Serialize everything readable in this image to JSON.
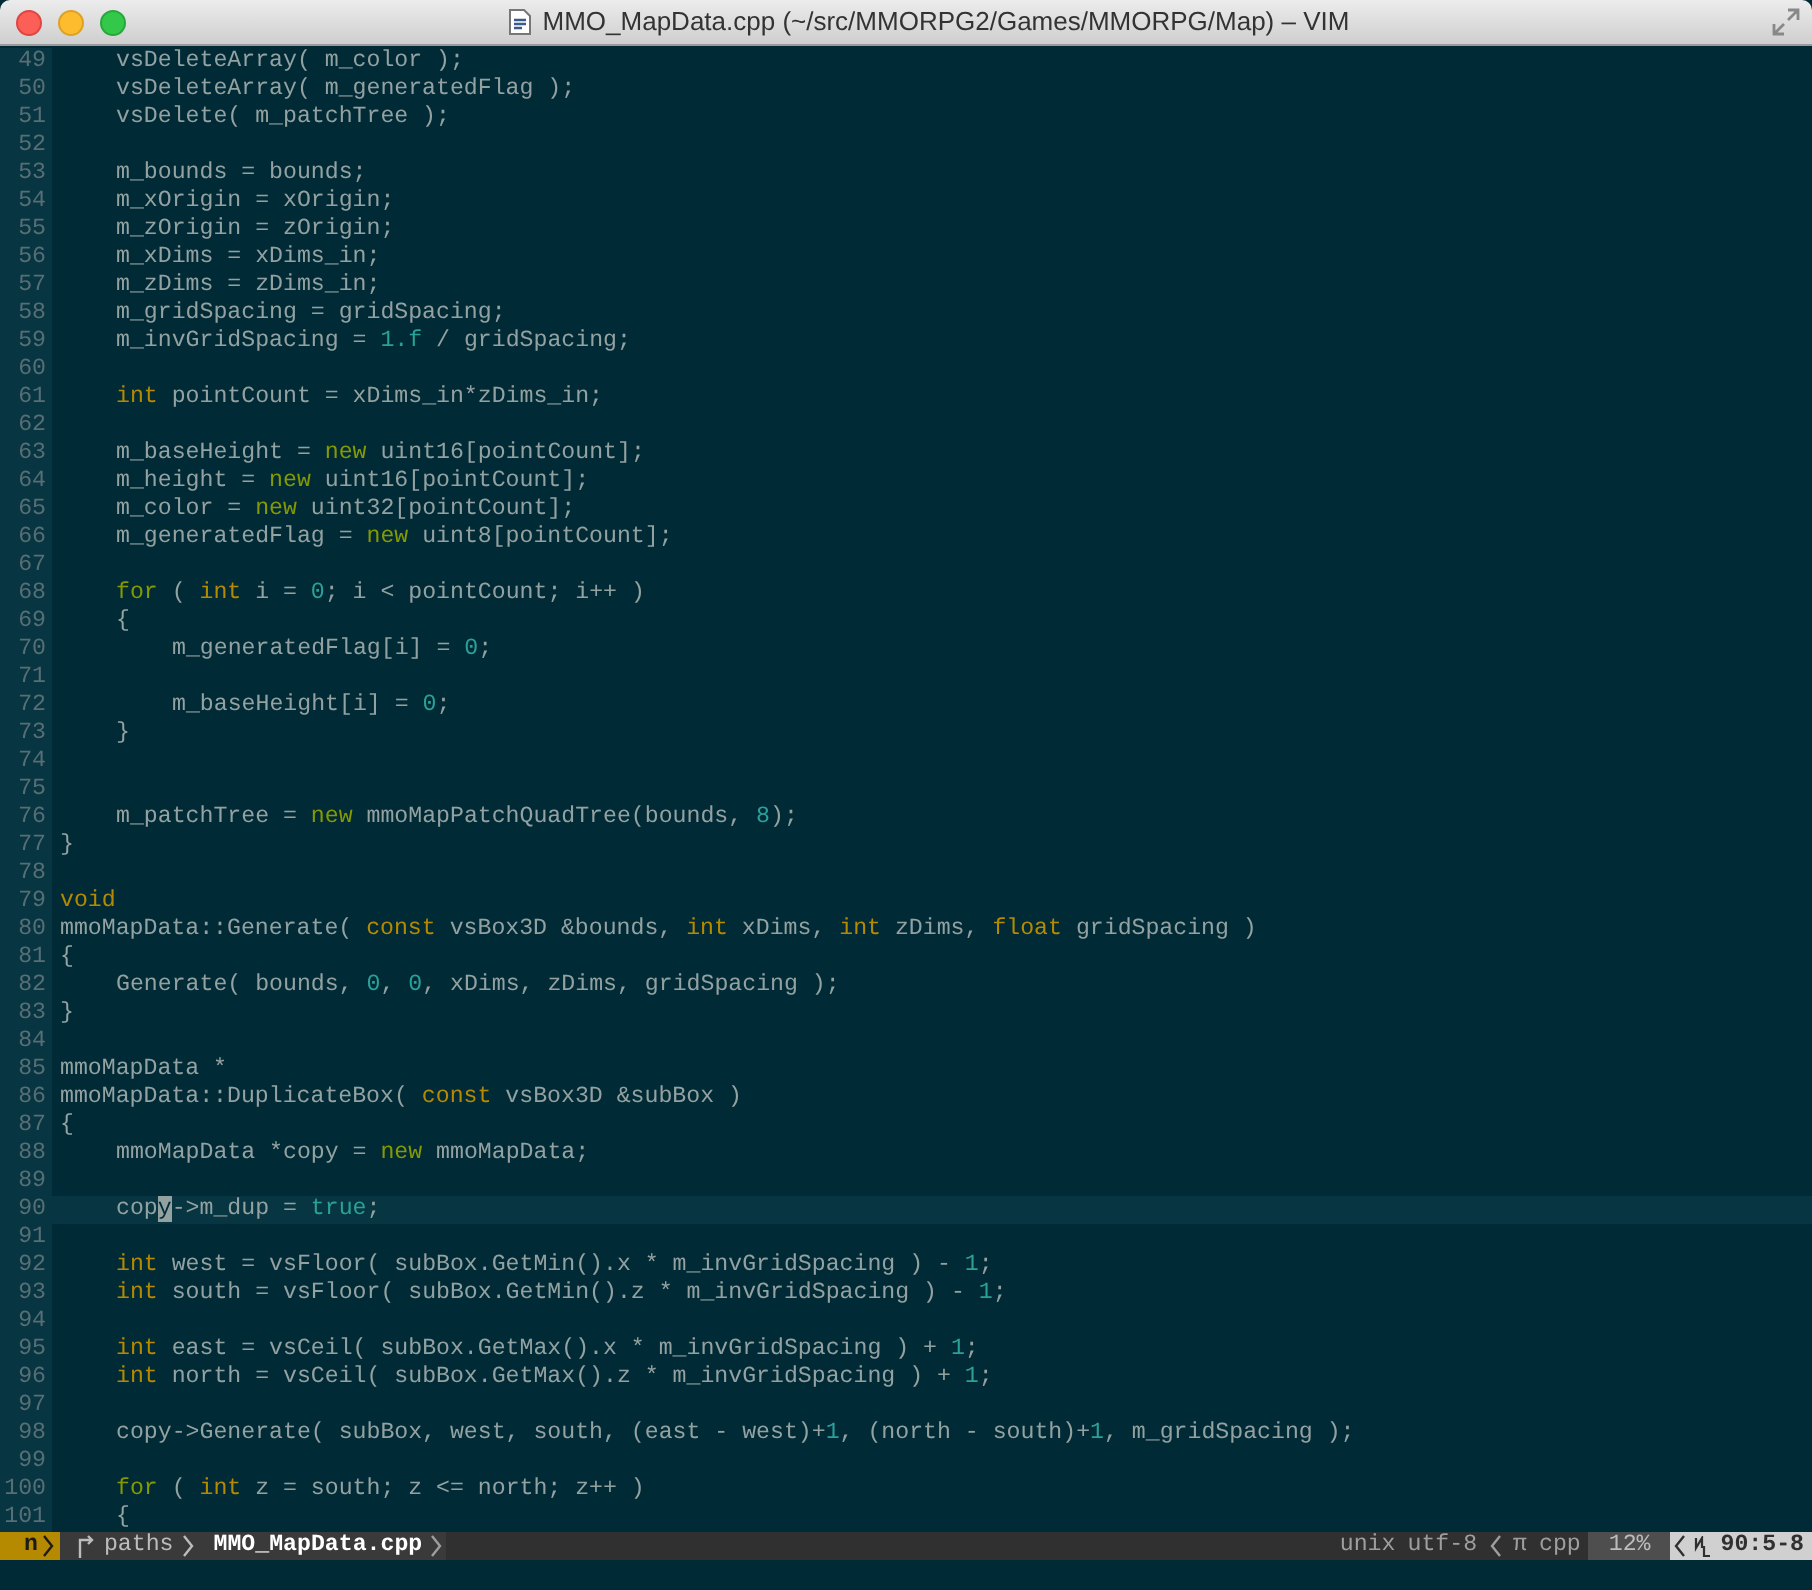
{
  "window": {
    "title": "MMO_MapData.cpp (~/src/MMORPG2/Games/MMORPG/Map) – VIM"
  },
  "editor": {
    "lines": [
      {
        "number": "49",
        "current": false,
        "segments": [
          {
            "kind": "plain",
            "text": "    vsDeleteArray( m_color );"
          }
        ]
      },
      {
        "number": "50",
        "current": false,
        "segments": [
          {
            "kind": "plain",
            "text": "    vsDeleteArray( m_generatedFlag );"
          }
        ]
      },
      {
        "number": "51",
        "current": false,
        "segments": [
          {
            "kind": "plain",
            "text": "    vsDelete( m_patchTree );"
          }
        ]
      },
      {
        "number": "52",
        "current": false
      },
      {
        "number": "53",
        "current": false,
        "segments": [
          {
            "kind": "plain",
            "text": "    m_bounds = bounds;"
          }
        ]
      },
      {
        "number": "54",
        "current": false,
        "segments": [
          {
            "kind": "plain",
            "text": "    m_xOrigin = xOrigin;"
          }
        ]
      },
      {
        "number": "55",
        "current": false,
        "segments": [
          {
            "kind": "plain",
            "text": "    m_zOrigin = zOrigin;"
          }
        ]
      },
      {
        "number": "56",
        "current": false,
        "segments": [
          {
            "kind": "plain",
            "text": "    m_xDims = xDims_in;"
          }
        ]
      },
      {
        "number": "57",
        "current": false,
        "segments": [
          {
            "kind": "plain",
            "text": "    m_zDims = zDims_in;"
          }
        ]
      },
      {
        "number": "58",
        "current": false,
        "segments": [
          {
            "kind": "plain",
            "text": "    m_gridSpacing = gridSpacing;"
          }
        ]
      },
      {
        "number": "59",
        "current": false,
        "segments": [
          {
            "kind": "plain",
            "text": "    m_invGridSpacing = "
          },
          {
            "kind": "number",
            "text": "1.f"
          },
          {
            "kind": "plain",
            "text": " / gridSpacing;"
          }
        ]
      },
      {
        "number": "60",
        "current": false
      },
      {
        "number": "61",
        "current": false,
        "segments": [
          {
            "kind": "type",
            "text": "    int"
          },
          {
            "kind": "plain",
            "text": " pointCount = xDims_in*zDims_in;"
          }
        ]
      },
      {
        "number": "62",
        "current": false
      },
      {
        "number": "63",
        "current": false,
        "segments": [
          {
            "kind": "plain",
            "text": "    m_baseHeight = "
          },
          {
            "kind": "keyword",
            "text": "new"
          },
          {
            "kind": "plain",
            "text": " uint16[pointCount];"
          }
        ]
      },
      {
        "number": "64",
        "current": false,
        "segments": [
          {
            "kind": "plain",
            "text": "    m_height = "
          },
          {
            "kind": "keyword",
            "text": "new"
          },
          {
            "kind": "plain",
            "text": " uint16[pointCount];"
          }
        ]
      },
      {
        "number": "65",
        "current": false,
        "segments": [
          {
            "kind": "plain",
            "text": "    m_color = "
          },
          {
            "kind": "keyword",
            "text": "new"
          },
          {
            "kind": "plain",
            "text": " uint32[pointCount];"
          }
        ]
      },
      {
        "number": "66",
        "current": false,
        "segments": [
          {
            "kind": "plain",
            "text": "    m_generatedFlag = "
          },
          {
            "kind": "keyword",
            "text": "new"
          },
          {
            "kind": "plain",
            "text": " uint8[pointCount];"
          }
        ]
      },
      {
        "number": "67",
        "current": false
      },
      {
        "number": "68",
        "current": false,
        "segments": [
          {
            "kind": "keyword",
            "text": "    for"
          },
          {
            "kind": "plain",
            "text": " ( "
          },
          {
            "kind": "type",
            "text": "int"
          },
          {
            "kind": "plain",
            "text": " i = "
          },
          {
            "kind": "number",
            "text": "0"
          },
          {
            "kind": "plain",
            "text": "; i < pointCount; i++ )"
          }
        ]
      },
      {
        "number": "69",
        "current": false,
        "segments": [
          {
            "kind": "plain",
            "text": "    {"
          }
        ]
      },
      {
        "number": "70",
        "current": false,
        "segments": [
          {
            "kind": "plain",
            "text": "        m_generatedFlag[i] = "
          },
          {
            "kind": "number",
            "text": "0"
          },
          {
            "kind": "plain",
            "text": ";"
          }
        ]
      },
      {
        "number": "71",
        "current": false
      },
      {
        "number": "72",
        "current": false,
        "segments": [
          {
            "kind": "plain",
            "text": "        m_baseHeight[i] = "
          },
          {
            "kind": "number",
            "text": "0"
          },
          {
            "kind": "plain",
            "text": ";"
          }
        ]
      },
      {
        "number": "73",
        "current": false,
        "segments": [
          {
            "kind": "plain",
            "text": "    }"
          }
        ]
      },
      {
        "number": "74",
        "current": false
      },
      {
        "number": "75",
        "current": false
      },
      {
        "number": "76",
        "current": false,
        "segments": [
          {
            "kind": "plain",
            "text": "    m_patchTree = "
          },
          {
            "kind": "keyword",
            "text": "new"
          },
          {
            "kind": "plain",
            "text": " mmoMapPatchQuadTree(bounds, "
          },
          {
            "kind": "number",
            "text": "8"
          },
          {
            "kind": "plain",
            "text": ");"
          }
        ]
      },
      {
        "number": "77",
        "current": false,
        "segments": [
          {
            "kind": "plain",
            "text": "}"
          }
        ]
      },
      {
        "number": "78",
        "current": false
      },
      {
        "number": "79",
        "current": false,
        "segments": [
          {
            "kind": "type",
            "text": "void"
          }
        ]
      },
      {
        "number": "80",
        "current": false,
        "segments": [
          {
            "kind": "plain",
            "text": "mmoMapData::Generate( "
          },
          {
            "kind": "type",
            "text": "const"
          },
          {
            "kind": "plain",
            "text": " vsBox3D &bounds, "
          },
          {
            "kind": "type",
            "text": "int"
          },
          {
            "kind": "plain",
            "text": " xDims, "
          },
          {
            "kind": "type",
            "text": "int"
          },
          {
            "kind": "plain",
            "text": " zDims, "
          },
          {
            "kind": "type",
            "text": "float"
          },
          {
            "kind": "plain",
            "text": " gridSpacing )"
          }
        ]
      },
      {
        "number": "81",
        "current": false,
        "segments": [
          {
            "kind": "plain",
            "text": "{"
          }
        ]
      },
      {
        "number": "82",
        "current": false,
        "segments": [
          {
            "kind": "plain",
            "text": "    Generate( bounds, "
          },
          {
            "kind": "number",
            "text": "0"
          },
          {
            "kind": "plain",
            "text": ", "
          },
          {
            "kind": "number",
            "text": "0"
          },
          {
            "kind": "plain",
            "text": ", xDims, zDims, gridSpacing );"
          }
        ]
      },
      {
        "number": "83",
        "current": false,
        "segments": [
          {
            "kind": "plain",
            "text": "}"
          }
        ]
      },
      {
        "number": "84",
        "current": false
      },
      {
        "number": "85",
        "current": false,
        "segments": [
          {
            "kind": "plain",
            "text": "mmoMapData *"
          }
        ]
      },
      {
        "number": "86",
        "current": false,
        "segments": [
          {
            "kind": "plain",
            "text": "mmoMapData::DuplicateBox( "
          },
          {
            "kind": "type",
            "text": "const"
          },
          {
            "kind": "plain",
            "text": " vsBox3D &subBox )"
          }
        ]
      },
      {
        "number": "87",
        "current": false,
        "segments": [
          {
            "kind": "plain",
            "text": "{"
          }
        ]
      },
      {
        "number": "88",
        "current": false,
        "segments": [
          {
            "kind": "plain",
            "text": "    mmoMapData *copy = "
          },
          {
            "kind": "keyword",
            "text": "new"
          },
          {
            "kind": "plain",
            "text": " mmoMapData;"
          }
        ]
      },
      {
        "number": "89",
        "current": false
      },
      {
        "number": "90",
        "current": true,
        "segments": [
          {
            "kind": "plain",
            "text": "    cop"
          },
          {
            "kind": "cursor",
            "text": "y"
          },
          {
            "kind": "plain",
            "text": "->m_dup = "
          },
          {
            "kind": "number",
            "text": "true"
          },
          {
            "kind": "plain",
            "text": ";"
          }
        ]
      },
      {
        "number": "91",
        "current": false
      },
      {
        "number": "92",
        "current": false,
        "segments": [
          {
            "kind": "type",
            "text": "    int"
          },
          {
            "kind": "plain",
            "text": " west = vsFloor( subBox.GetMin().x * m_invGridSpacing ) - "
          },
          {
            "kind": "number",
            "text": "1"
          },
          {
            "kind": "plain",
            "text": ";"
          }
        ]
      },
      {
        "number": "93",
        "current": false,
        "segments": [
          {
            "kind": "type",
            "text": "    int"
          },
          {
            "kind": "plain",
            "text": " south = vsFloor( subBox.GetMin().z * m_invGridSpacing ) - "
          },
          {
            "kind": "number",
            "text": "1"
          },
          {
            "kind": "plain",
            "text": ";"
          }
        ]
      },
      {
        "number": "94",
        "current": false
      },
      {
        "number": "95",
        "current": false,
        "segments": [
          {
            "kind": "type",
            "text": "    int"
          },
          {
            "kind": "plain",
            "text": " east = vsCeil( subBox.GetMax().x * m_invGridSpacing ) + "
          },
          {
            "kind": "number",
            "text": "1"
          },
          {
            "kind": "plain",
            "text": ";"
          }
        ]
      },
      {
        "number": "96",
        "current": false,
        "segments": [
          {
            "kind": "type",
            "text": "    int"
          },
          {
            "kind": "plain",
            "text": " north = vsCeil( subBox.GetMax().z * m_invGridSpacing ) + "
          },
          {
            "kind": "number",
            "text": "1"
          },
          {
            "kind": "plain",
            "text": ";"
          }
        ]
      },
      {
        "number": "97",
        "current": false
      },
      {
        "number": "98",
        "current": false,
        "segments": [
          {
            "kind": "plain",
            "text": "    copy->Generate( subBox, west, south, (east - west)+"
          },
          {
            "kind": "number",
            "text": "1"
          },
          {
            "kind": "plain",
            "text": ", (north - south)+"
          },
          {
            "kind": "number",
            "text": "1"
          },
          {
            "kind": "plain",
            "text": ", m_gridSpacing );"
          }
        ]
      },
      {
        "number": "99",
        "current": false
      },
      {
        "number": "100",
        "current": false,
        "segments": [
          {
            "kind": "keyword",
            "text": "    for"
          },
          {
            "kind": "plain",
            "text": " ( "
          },
          {
            "kind": "type",
            "text": "int"
          },
          {
            "kind": "plain",
            "text": " z = south; z <= north; z++ )"
          }
        ]
      },
      {
        "number": "101",
        "current": false,
        "segments": [
          {
            "kind": "plain",
            "text": "    {"
          }
        ]
      }
    ]
  },
  "status_bar": {
    "mode": "n",
    "branch": "paths",
    "file": "MMO_MapData.cpp",
    "format": "unix",
    "encoding": "utf-8",
    "filetype_symbol": "π",
    "filetype": "cpp",
    "percent": "12%",
    "position": "90:5-8"
  }
}
